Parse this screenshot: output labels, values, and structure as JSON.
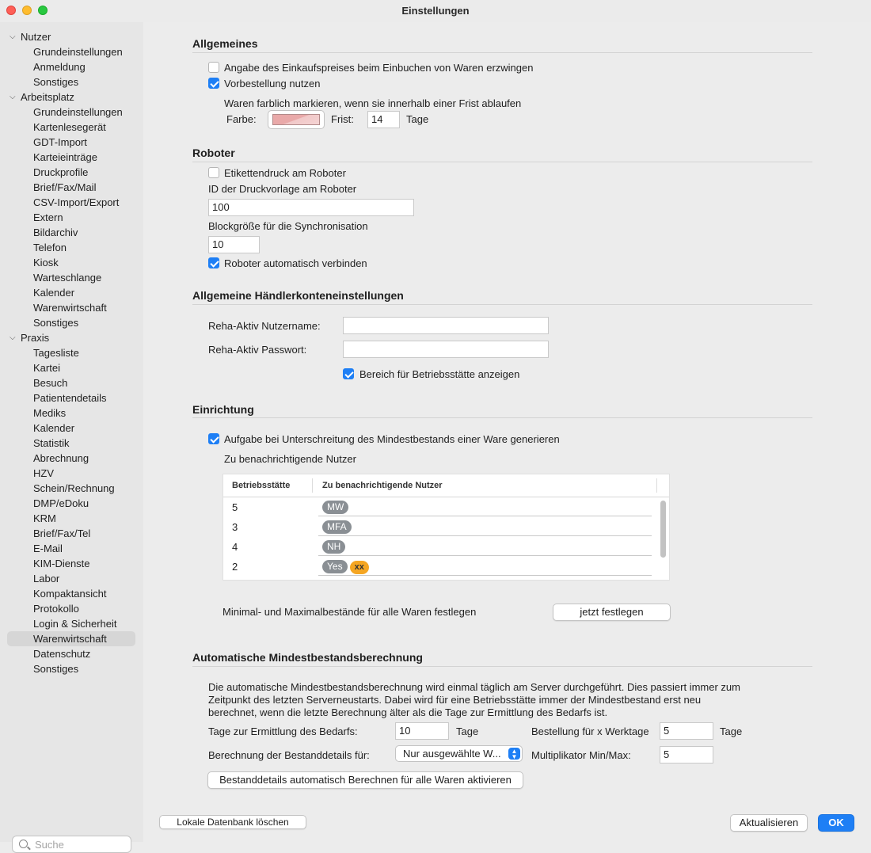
{
  "window": {
    "title": "Einstellungen"
  },
  "sidebar": {
    "groups": [
      {
        "label": "Nutzer",
        "items": [
          "Grundeinstellungen",
          "Anmeldung",
          "Sonstiges"
        ]
      },
      {
        "label": "Arbeitsplatz",
        "items": [
          "Grundeinstellungen",
          "Kartenlesegerät",
          "GDT-Import",
          "Karteieinträge",
          "Druckprofile",
          "Brief/Fax/Mail",
          "CSV-Import/Export",
          "Extern",
          "Bildarchiv",
          "Telefon",
          "Kiosk",
          "Warteschlange",
          "Kalender",
          "Warenwirtschaft",
          "Sonstiges"
        ]
      },
      {
        "label": "Praxis",
        "items": [
          "Tagesliste",
          "Kartei",
          "Besuch",
          "Patientendetails",
          "Mediks",
          "Kalender",
          "Statistik",
          "Abrechnung",
          "HZV",
          "Schein/Rechnung",
          "DMP/eDoku",
          "KRM",
          "Brief/Fax/Tel",
          "E-Mail",
          "KIM-Dienste",
          "Labor",
          "Kompaktansicht",
          "Protokollo",
          "Login & Sicherheit",
          "Warenwirtschaft",
          "Datenschutz",
          "Sonstiges"
        ]
      }
    ],
    "selected": "Praxis / Warenwirtschaft",
    "search_placeholder": "Suche"
  },
  "allgemeines": {
    "title": "Allgemeines",
    "einkaufspreis_label": "Angabe des Einkaufspreises beim Einbuchen von Waren erzwingen",
    "einkaufspreis_checked": false,
    "vorbestellung_label": "Vorbestellung nutzen",
    "vorbestellung_checked": true,
    "frist_hint": "Waren farblich markieren, wenn sie innerhalb einer Frist ablaufen",
    "farbe_label": "Farbe:",
    "farbe_color": "#e9a9a9",
    "frist_label": "Frist:",
    "frist_value": "14",
    "tage_label": "Tage"
  },
  "roboter": {
    "title": "Roboter",
    "etikettendruck_label": "Etikettendruck am Roboter",
    "etikettendruck_checked": false,
    "druckvorlage_label": "ID der Druckvorlage am Roboter",
    "druckvorlage_value": "100",
    "blockgroesse_label": "Blockgröße für die Synchronisation",
    "blockgroesse_value": "10",
    "auto_verbinden_label": "Roboter automatisch verbinden",
    "auto_verbinden_checked": true
  },
  "haendler": {
    "title": "Allgemeine Händlerkonteneinstellungen",
    "nutzername_label": "Reha-Aktiv Nutzername:",
    "nutzername_value": "",
    "passwort_label": "Reha-Aktiv Passwort:",
    "passwort_value": "",
    "bereich_label": "Bereich für Betriebsstätte anzeigen",
    "bereich_checked": true
  },
  "einrichtung": {
    "title": "Einrichtung",
    "aufgabe_label": "Aufgabe bei Unterschreitung des Mindestbestands einer Ware generieren",
    "aufgabe_checked": true,
    "nutzer_label": "Zu benachrichtigende Nutzer",
    "table": {
      "columns": [
        "Betriebsstätte",
        "Zu benachrichtigende Nutzer"
      ],
      "rows": [
        {
          "betriebsstaette": "5",
          "nutzer": [
            "MW"
          ]
        },
        {
          "betriebsstaette": "3",
          "nutzer": [
            "MFA"
          ]
        },
        {
          "betriebsstaette": "4",
          "nutzer": [
            "NH"
          ]
        },
        {
          "betriebsstaette": "2",
          "nutzer": [
            "Yes",
            "xx"
          ]
        }
      ]
    },
    "minmax_label": "Minimal- und Maximalbestände für alle Waren festlegen",
    "festlegen_button": "jetzt festlegen"
  },
  "auto_berechnung": {
    "title": "Automatische Mindestbestandsberechnung",
    "description_lines": [
      "Die automatische Mindestbestandsberechnung wird einmal täglich am Server durchgeführt. Dies passiert immer zum",
      "Zeitpunkt des letzten Serverneustarts. Dabei wird für eine Betriebsstätte immer der Mindestbestand erst neu",
      "berechnet, wenn die letzte Berechnung älter als die Tage zur Ermittlung des Bedarfs ist."
    ],
    "tage_bedarf_label": "Tage zur Ermittlung des Bedarfs:",
    "tage_bedarf_value": "10",
    "tage_unit": "Tage",
    "bestellung_label": "Bestellung für x Werktage",
    "bestellung_value": "5",
    "bestellung_unit": "Tage",
    "bestanddetails_label": "Berechnung der Bestanddetails für:",
    "bestanddetails_value": "Nur ausgewählte W...",
    "multiplikator_label": "Multiplikator Min/Max:",
    "multiplikator_value": "5",
    "aktivieren_button": "Bestanddetails automatisch Berechnen für alle Waren aktivieren"
  },
  "footer": {
    "lokale_db_button": "Lokale Datenbank löschen",
    "aktualisieren_button": "Aktualisieren",
    "ok_button": "OK"
  }
}
